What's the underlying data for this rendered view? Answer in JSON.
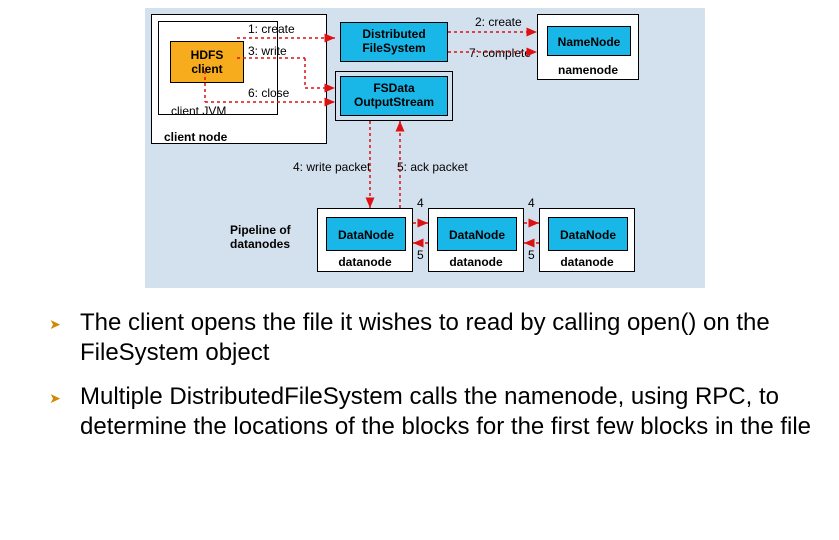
{
  "diagram": {
    "client": {
      "hdfs": "HDFS\nclient",
      "jvm": "client JVM",
      "node": "client node"
    },
    "dfs": "Distributed\nFileSystem",
    "fsdata": "FSData\nOutputStream",
    "namenode": {
      "box": "NameNode",
      "label": "namenode"
    },
    "datanode": {
      "box": "DataNode",
      "label": "datanode"
    },
    "pipeline": "Pipeline of\ndatanodes",
    "edges": {
      "e1": "1: create",
      "e2": "2: create",
      "e3": "3: write",
      "e4": "4: write packet",
      "e5": "5: ack packet",
      "e6": "6: close",
      "e7": "7: complete",
      "n4": "4",
      "n5": "5"
    }
  },
  "bullets": {
    "b1": "The client opens the file it wishes to read by calling open() on the FileSystem object",
    "b2": "Multiple DistributedFileSystem calls the namenode, using RPC, to determine the locations of the blocks for the first few blocks in the file"
  },
  "chart_data": {
    "type": "diagram",
    "nodes": [
      {
        "id": "hdfs-client",
        "label": "HDFS client",
        "group": "client JVM / client node"
      },
      {
        "id": "dfs",
        "label": "Distributed FileSystem",
        "group": "client node"
      },
      {
        "id": "fsdata",
        "label": "FSData OutputStream",
        "group": "client node"
      },
      {
        "id": "namenode",
        "label": "NameNode",
        "group": "namenode"
      },
      {
        "id": "dn1",
        "label": "DataNode",
        "group": "datanode"
      },
      {
        "id": "dn2",
        "label": "DataNode",
        "group": "datanode"
      },
      {
        "id": "dn3",
        "label": "DataNode",
        "group": "datanode"
      }
    ],
    "edges": [
      {
        "from": "hdfs-client",
        "to": "dfs",
        "label": "1: create"
      },
      {
        "from": "dfs",
        "to": "namenode",
        "label": "2: create"
      },
      {
        "from": "hdfs-client",
        "to": "fsdata",
        "label": "3: write"
      },
      {
        "from": "fsdata",
        "to": "dn1",
        "label": "4: write packet"
      },
      {
        "from": "dn1",
        "to": "dn2",
        "label": "4"
      },
      {
        "from": "dn2",
        "to": "dn3",
        "label": "4"
      },
      {
        "from": "dn3",
        "to": "dn2",
        "label": "5"
      },
      {
        "from": "dn2",
        "to": "dn1",
        "label": "5"
      },
      {
        "from": "dn1",
        "to": "fsdata",
        "label": "5: ack packet"
      },
      {
        "from": "hdfs-client",
        "to": "fsdata",
        "label": "6: close"
      },
      {
        "from": "dfs",
        "to": "namenode",
        "label": "7: complete"
      }
    ],
    "title": "HDFS write data flow",
    "annotation": "Pipeline of datanodes"
  }
}
